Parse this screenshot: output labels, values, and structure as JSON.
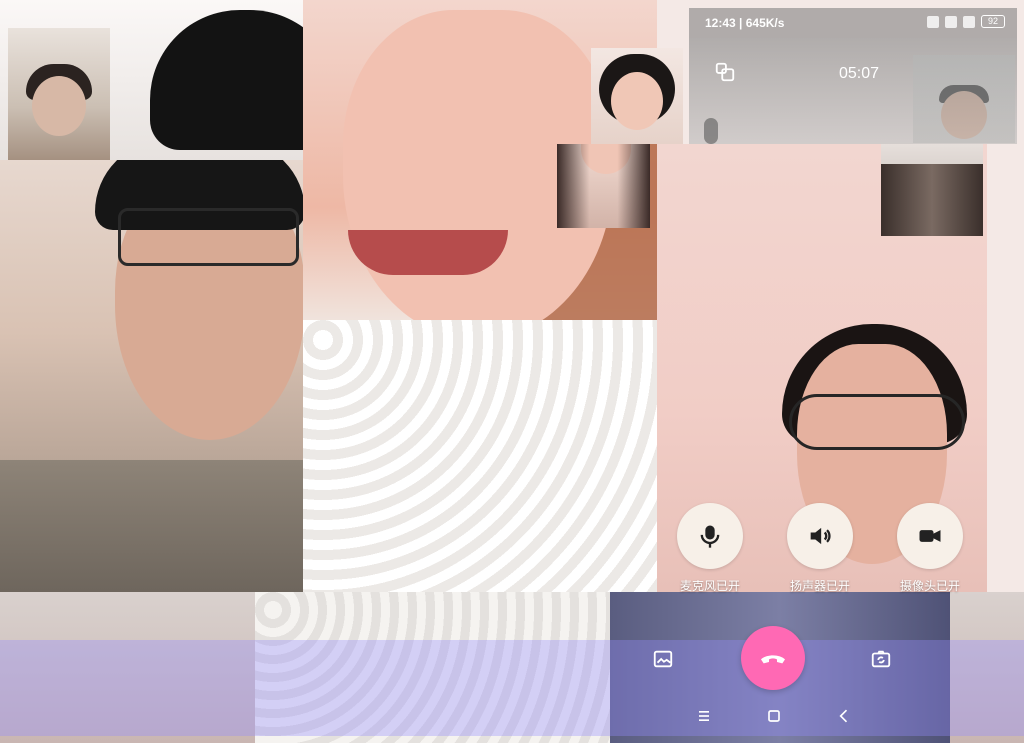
{
  "status_bar": {
    "time": "12:43",
    "speed": "| 645K/s",
    "battery": "92"
  },
  "call": {
    "timer": "05:07"
  },
  "controls": {
    "mic_label": "麦克风已开",
    "speaker_label": "扬声器已开",
    "camera_label": "摄像头已开"
  },
  "icons": {
    "minimize": "minimize-window-icon",
    "mic": "microphone-icon",
    "speaker": "speaker-icon",
    "camera": "video-camera-icon",
    "hangup": "hang-up-phone-icon",
    "gallery": "image-gallery-icon",
    "flip": "flip-camera-icon",
    "nav_menu": "menu-icon",
    "nav_home": "home-square-icon",
    "nav_back": "back-chevron-icon"
  },
  "colors": {
    "hangup": "#ff69b4",
    "control_bg": "#f7f0e8",
    "overlay": "#968cff"
  }
}
